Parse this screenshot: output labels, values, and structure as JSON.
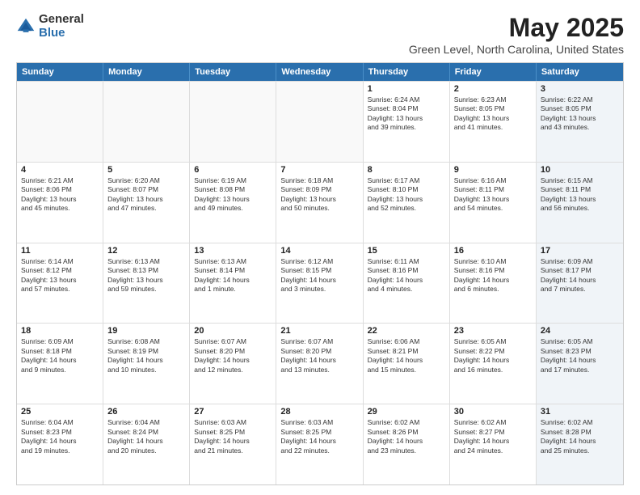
{
  "logo": {
    "general": "General",
    "blue": "Blue"
  },
  "title": "May 2025",
  "subtitle": "Green Level, North Carolina, United States",
  "days": [
    "Sunday",
    "Monday",
    "Tuesday",
    "Wednesday",
    "Thursday",
    "Friday",
    "Saturday"
  ],
  "rows": [
    [
      {
        "day": "",
        "text": "",
        "empty": true
      },
      {
        "day": "",
        "text": "",
        "empty": true
      },
      {
        "day": "",
        "text": "",
        "empty": true
      },
      {
        "day": "",
        "text": "",
        "empty": true
      },
      {
        "day": "1",
        "text": "Sunrise: 6:24 AM\nSunset: 8:04 PM\nDaylight: 13 hours\nand 39 minutes."
      },
      {
        "day": "2",
        "text": "Sunrise: 6:23 AM\nSunset: 8:05 PM\nDaylight: 13 hours\nand 41 minutes."
      },
      {
        "day": "3",
        "text": "Sunrise: 6:22 AM\nSunset: 8:05 PM\nDaylight: 13 hours\nand 43 minutes.",
        "shaded": true
      }
    ],
    [
      {
        "day": "4",
        "text": "Sunrise: 6:21 AM\nSunset: 8:06 PM\nDaylight: 13 hours\nand 45 minutes."
      },
      {
        "day": "5",
        "text": "Sunrise: 6:20 AM\nSunset: 8:07 PM\nDaylight: 13 hours\nand 47 minutes."
      },
      {
        "day": "6",
        "text": "Sunrise: 6:19 AM\nSunset: 8:08 PM\nDaylight: 13 hours\nand 49 minutes."
      },
      {
        "day": "7",
        "text": "Sunrise: 6:18 AM\nSunset: 8:09 PM\nDaylight: 13 hours\nand 50 minutes."
      },
      {
        "day": "8",
        "text": "Sunrise: 6:17 AM\nSunset: 8:10 PM\nDaylight: 13 hours\nand 52 minutes."
      },
      {
        "day": "9",
        "text": "Sunrise: 6:16 AM\nSunset: 8:11 PM\nDaylight: 13 hours\nand 54 minutes."
      },
      {
        "day": "10",
        "text": "Sunrise: 6:15 AM\nSunset: 8:11 PM\nDaylight: 13 hours\nand 56 minutes.",
        "shaded": true
      }
    ],
    [
      {
        "day": "11",
        "text": "Sunrise: 6:14 AM\nSunset: 8:12 PM\nDaylight: 13 hours\nand 57 minutes."
      },
      {
        "day": "12",
        "text": "Sunrise: 6:13 AM\nSunset: 8:13 PM\nDaylight: 13 hours\nand 59 minutes."
      },
      {
        "day": "13",
        "text": "Sunrise: 6:13 AM\nSunset: 8:14 PM\nDaylight: 14 hours\nand 1 minute."
      },
      {
        "day": "14",
        "text": "Sunrise: 6:12 AM\nSunset: 8:15 PM\nDaylight: 14 hours\nand 3 minutes."
      },
      {
        "day": "15",
        "text": "Sunrise: 6:11 AM\nSunset: 8:16 PM\nDaylight: 14 hours\nand 4 minutes."
      },
      {
        "day": "16",
        "text": "Sunrise: 6:10 AM\nSunset: 8:16 PM\nDaylight: 14 hours\nand 6 minutes."
      },
      {
        "day": "17",
        "text": "Sunrise: 6:09 AM\nSunset: 8:17 PM\nDaylight: 14 hours\nand 7 minutes.",
        "shaded": true
      }
    ],
    [
      {
        "day": "18",
        "text": "Sunrise: 6:09 AM\nSunset: 8:18 PM\nDaylight: 14 hours\nand 9 minutes."
      },
      {
        "day": "19",
        "text": "Sunrise: 6:08 AM\nSunset: 8:19 PM\nDaylight: 14 hours\nand 10 minutes."
      },
      {
        "day": "20",
        "text": "Sunrise: 6:07 AM\nSunset: 8:20 PM\nDaylight: 14 hours\nand 12 minutes."
      },
      {
        "day": "21",
        "text": "Sunrise: 6:07 AM\nSunset: 8:20 PM\nDaylight: 14 hours\nand 13 minutes."
      },
      {
        "day": "22",
        "text": "Sunrise: 6:06 AM\nSunset: 8:21 PM\nDaylight: 14 hours\nand 15 minutes."
      },
      {
        "day": "23",
        "text": "Sunrise: 6:05 AM\nSunset: 8:22 PM\nDaylight: 14 hours\nand 16 minutes."
      },
      {
        "day": "24",
        "text": "Sunrise: 6:05 AM\nSunset: 8:23 PM\nDaylight: 14 hours\nand 17 minutes.",
        "shaded": true
      }
    ],
    [
      {
        "day": "25",
        "text": "Sunrise: 6:04 AM\nSunset: 8:23 PM\nDaylight: 14 hours\nand 19 minutes."
      },
      {
        "day": "26",
        "text": "Sunrise: 6:04 AM\nSunset: 8:24 PM\nDaylight: 14 hours\nand 20 minutes."
      },
      {
        "day": "27",
        "text": "Sunrise: 6:03 AM\nSunset: 8:25 PM\nDaylight: 14 hours\nand 21 minutes."
      },
      {
        "day": "28",
        "text": "Sunrise: 6:03 AM\nSunset: 8:25 PM\nDaylight: 14 hours\nand 22 minutes."
      },
      {
        "day": "29",
        "text": "Sunrise: 6:02 AM\nSunset: 8:26 PM\nDaylight: 14 hours\nand 23 minutes."
      },
      {
        "day": "30",
        "text": "Sunrise: 6:02 AM\nSunset: 8:27 PM\nDaylight: 14 hours\nand 24 minutes."
      },
      {
        "day": "31",
        "text": "Sunrise: 6:02 AM\nSunset: 8:28 PM\nDaylight: 14 hours\nand 25 minutes.",
        "shaded": true
      }
    ]
  ]
}
